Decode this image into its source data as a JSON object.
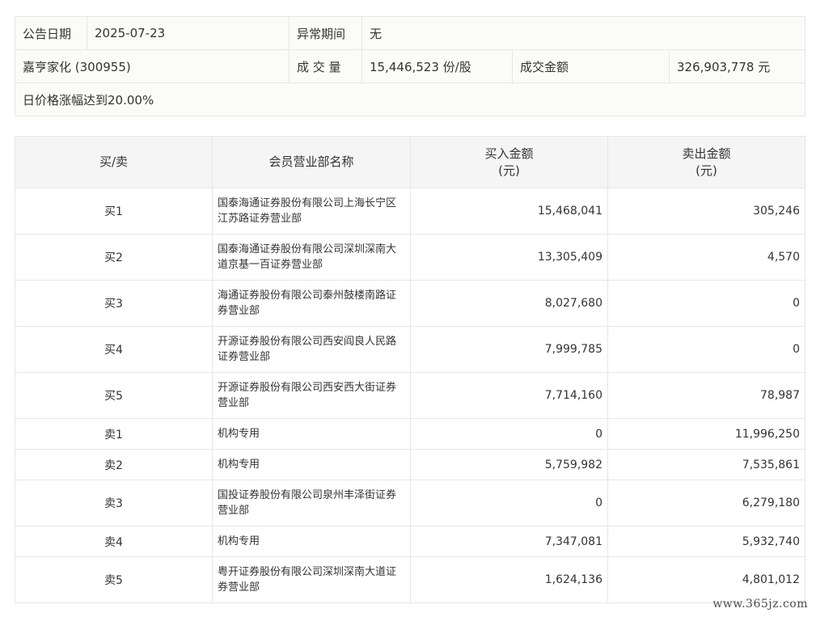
{
  "info": {
    "row1": {
      "date_label": "公告日期",
      "date_value": "2025-07-23",
      "abnormal_label": "异常期间",
      "abnormal_value": "无"
    },
    "row2": {
      "stock": "嘉亨家化 (300955)",
      "volume_label": "成 交 量",
      "volume_value": "15,446,523 份/股",
      "amount_label": "成交金额",
      "amount_value": "326,903,778 元"
    },
    "row3": {
      "reason": "日价格涨幅达到20.00%"
    }
  },
  "trade": {
    "headers": {
      "side": "买/卖",
      "broker": "会员营业部名称",
      "buy_line1": "买入金额",
      "buy_line2": "(元)",
      "sell_line1": "卖出金额",
      "sell_line2": "(元)"
    },
    "rows": [
      {
        "side": "买1",
        "broker": "国泰海通证券股份有限公司上海长宁区江苏路证券营业部",
        "buy": "15,468,041",
        "sell": "305,246"
      },
      {
        "side": "买2",
        "broker": "国泰海通证券股份有限公司深圳深南大道京基一百证券营业部",
        "buy": "13,305,409",
        "sell": "4,570"
      },
      {
        "side": "买3",
        "broker": "海通证券股份有限公司泰州鼓楼南路证券营业部",
        "buy": "8,027,680",
        "sell": "0"
      },
      {
        "side": "买4",
        "broker": "开源证券股份有限公司西安阎良人民路证券营业部",
        "buy": "7,999,785",
        "sell": "0"
      },
      {
        "side": "买5",
        "broker": "开源证券股份有限公司西安西大街证券营业部",
        "buy": "7,714,160",
        "sell": "78,987"
      },
      {
        "side": "卖1",
        "broker": "机构专用",
        "buy": "0",
        "sell": "11,996,250"
      },
      {
        "side": "卖2",
        "broker": "机构专用",
        "buy": "5,759,982",
        "sell": "7,535,861"
      },
      {
        "side": "卖3",
        "broker": "国投证券股份有限公司泉州丰泽街证券营业部",
        "buy": "0",
        "sell": "6,279,180"
      },
      {
        "side": "卖4",
        "broker": "机构专用",
        "buy": "7,347,081",
        "sell": "5,932,740"
      },
      {
        "side": "卖5",
        "broker": "粤开证券股份有限公司深圳深南大道证券营业部",
        "buy": "1,624,136",
        "sell": "4,801,012"
      }
    ]
  },
  "watermark": "www.365jz.com"
}
